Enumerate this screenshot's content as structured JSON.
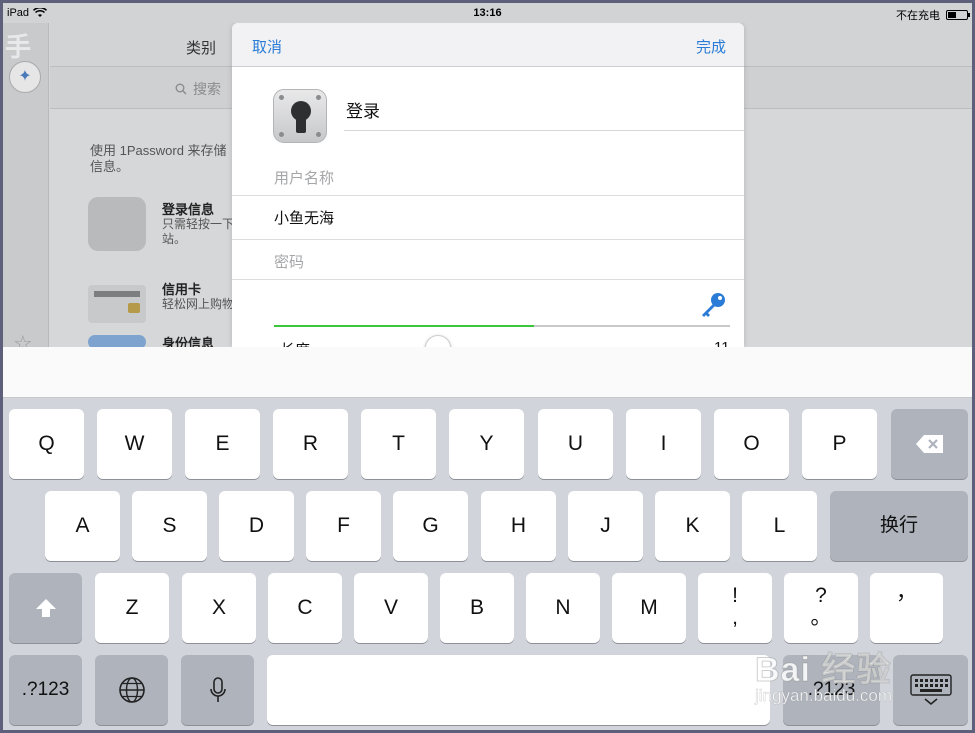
{
  "status_bar": {
    "device": "iPad",
    "time": "13:16",
    "charge_text": "不在充电"
  },
  "background_app": {
    "sidebar_char": "手",
    "header_title": "类别",
    "search_placeholder": "搜索",
    "intro_text": "使用 1Password 来存储信息。",
    "items": [
      {
        "name": "登录信息",
        "desc": "只需轻按一下站。"
      },
      {
        "name": "信用卡",
        "desc": "轻松网上购物"
      },
      {
        "name": "身份信息",
        "desc": ""
      }
    ]
  },
  "modal": {
    "cancel_label": "取消",
    "done_label": "完成",
    "title": "登录",
    "username_label": "用户名称",
    "username_value": "小鱼无海",
    "password_label": "密码",
    "password_value": "",
    "strength_fraction": 0.57,
    "length_label": "长度",
    "length_value": "11",
    "slider_fraction": 0.3
  },
  "keyboard": {
    "row1": [
      "Q",
      "W",
      "E",
      "R",
      "T",
      "Y",
      "U",
      "I",
      "O",
      "P"
    ],
    "row2": [
      "A",
      "S",
      "D",
      "F",
      "G",
      "H",
      "J",
      "K",
      "L"
    ],
    "return_label": "换行",
    "row3": [
      "Z",
      "X",
      "C",
      "V",
      "B",
      "N",
      "M"
    ],
    "punct1_top": "!",
    "punct1_bot": ",",
    "punct2_top": "?",
    "punct2_bot": "。",
    "punct3": "，",
    "numbers_label_left": ".?123",
    "numbers_label_right": ".?123"
  },
  "watermark": {
    "brand": "Bai 经验",
    "url": "jingyan.baidu.com"
  },
  "colors": {
    "accent": "#2a7cd6",
    "strength": "#3cc63c",
    "keyboard_bg": "#d1d4da"
  }
}
